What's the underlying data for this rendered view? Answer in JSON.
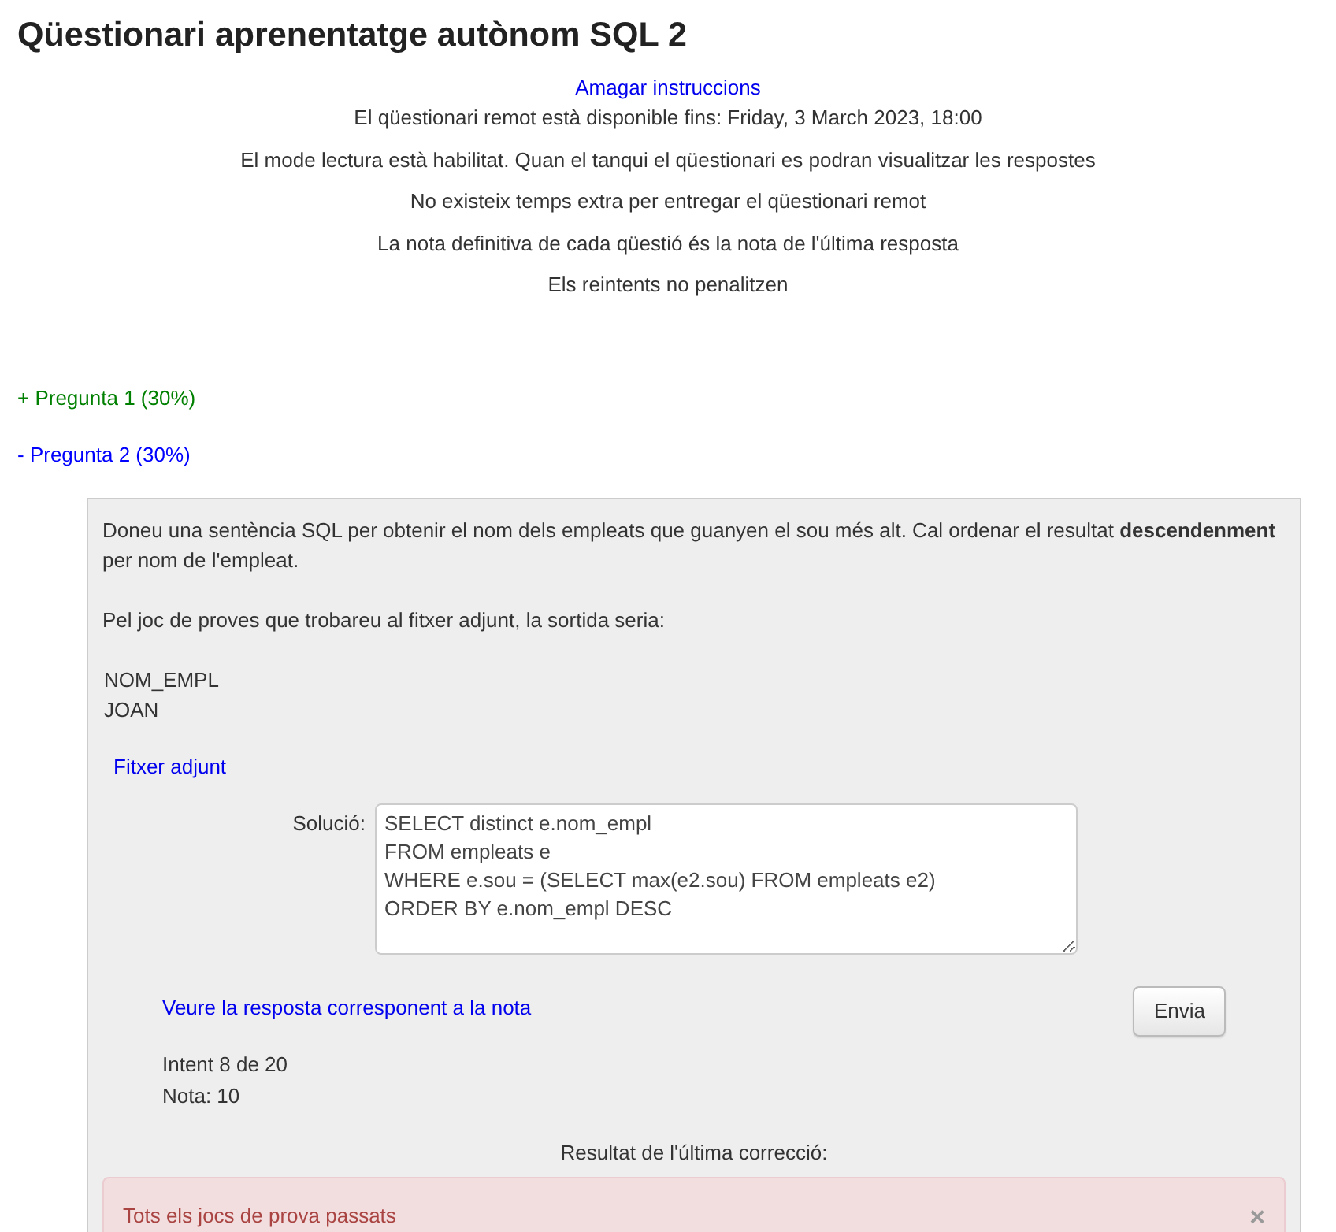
{
  "title": "Qüestionari aprenentatge autònom SQL 2",
  "instructions_link": "Amagar instruccions",
  "instructions": [
    "El qüestionari remot està disponible fins: Friday, 3 March 2023, 18:00",
    "El mode lectura està habilitat. Quan el tanqui el qüestionari es podran visualitzar les respostes",
    "No existeix temps extra per entregar el qüestionari remot",
    "La nota definitiva de cada qüestió és la nota de l'última resposta",
    "Els reintents no penalitzen"
  ],
  "questions": [
    {
      "label": "+ Pregunta 1 (30%)",
      "color": "#008000"
    },
    {
      "label": "- Pregunta 2 (30%)",
      "color": "#0000ff",
      "panel": {
        "statement": "Doneu una sentència SQL per obtenir el nom dels empleats que guanyen el sou més alt. Cal ordenar el resultat **descendenment** per nom de l'empleat.",
        "sample_intro": "Pel joc de proves que trobareu al fitxer adjunt, la sortida seria:",
        "sample_output": [
          "NOM_EMPL",
          "JOAN"
        ],
        "attachment_link": "Fitxer adjunt",
        "solution_label": "Solució:",
        "solution_value": "SELECT distinct e.nom_empl\nFROM empleats e\nWHERE e.sou = (SELECT max(e2.sou) FROM empleats e2)\nORDER BY e.nom_empl DESC",
        "answer_link": "Veure la resposta corresponent a la nota",
        "submit_button": "Envia",
        "attempt": "Intent 8 de 20",
        "grade": "Nota: 10",
        "result_heading": "Resultat de l'última correcció:",
        "result_alert": {
          "text": "Tots els jocs de prova passats",
          "close": "×"
        }
      }
    }
  ]
}
